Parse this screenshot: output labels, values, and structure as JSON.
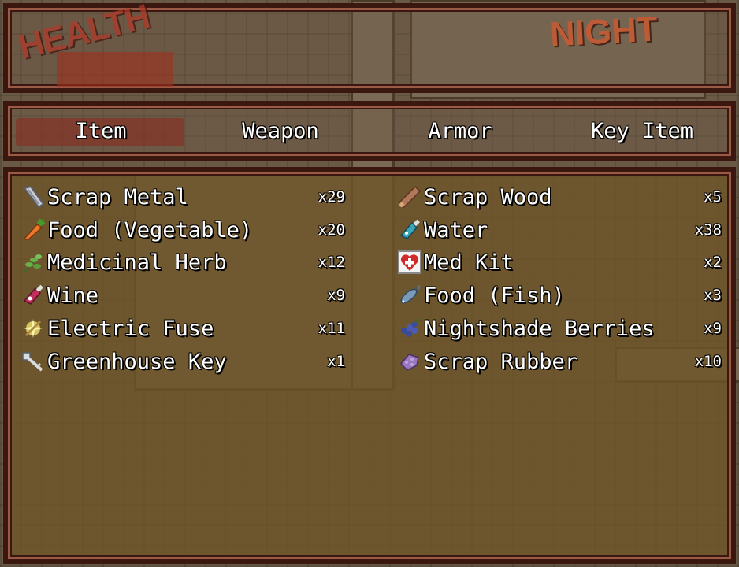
{
  "hud": {
    "health_logo": "HEALTH",
    "night_logo": "NIGHT"
  },
  "tabs": [
    "Item",
    "Weapon",
    "Armor",
    "Key Item"
  ],
  "selected_tab": "Item",
  "items_left": [
    {
      "name": "Scrap Metal",
      "qty": "x29",
      "icon": "scrap-metal-icon"
    },
    {
      "name": "Food (Vegetable)",
      "qty": "x20",
      "icon": "carrot-icon"
    },
    {
      "name": "Medicinal Herb",
      "qty": "x12",
      "icon": "herb-icon"
    },
    {
      "name": "Wine",
      "qty": "x9",
      "icon": "wine-bottle-icon"
    },
    {
      "name": "Electric Fuse",
      "qty": "x11",
      "icon": "fuse-icon"
    },
    {
      "name": "Greenhouse Key",
      "qty": "x1",
      "icon": "key-icon"
    }
  ],
  "items_right": [
    {
      "name": "Scrap Wood",
      "qty": "x5",
      "icon": "wood-icon"
    },
    {
      "name": "Water",
      "qty": "x38",
      "icon": "water-bottle-icon"
    },
    {
      "name": "Med Kit",
      "qty": "x2",
      "icon": "medkit-icon"
    },
    {
      "name": "Food (Fish)",
      "qty": "x3",
      "icon": "fish-icon"
    },
    {
      "name": "Nightshade Berries",
      "qty": "x9",
      "icon": "berries-icon"
    },
    {
      "name": "Scrap Rubber",
      "qty": "x10",
      "icon": "rubber-icon"
    }
  ]
}
